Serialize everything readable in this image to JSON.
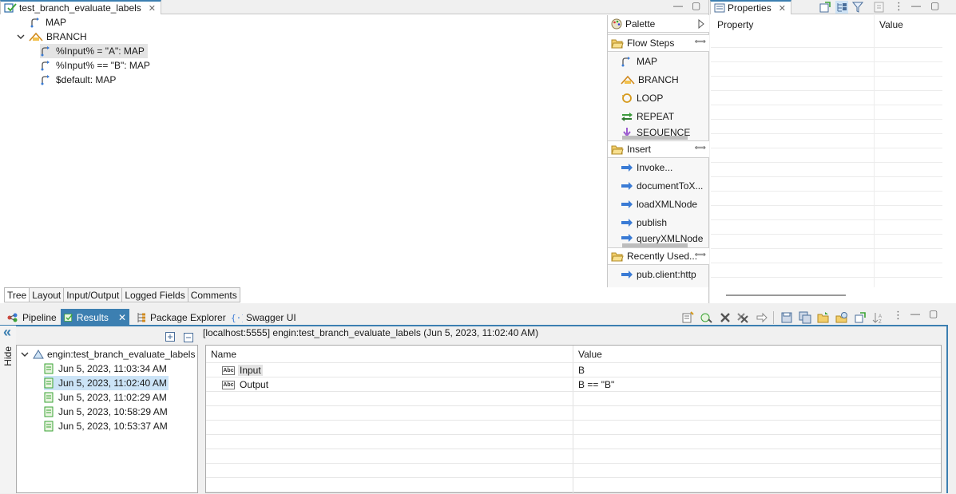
{
  "editor": {
    "tab_title": "test_branch_evaluate_labels",
    "close_glyph": "✕",
    "minimize_glyph": "—",
    "maximize_glyph": "▢",
    "tree": [
      {
        "label": "MAP",
        "icon": "map-icon"
      },
      {
        "label": "BRANCH",
        "icon": "branch-icon",
        "expanded": true
      },
      {
        "label": "%Input% = \"A\": MAP",
        "icon": "map-icon",
        "selected": true
      },
      {
        "label": "%Input% == \"B\": MAP",
        "icon": "map-icon"
      },
      {
        "label": "$default: MAP",
        "icon": "map-icon"
      }
    ],
    "bottom_tabs": [
      "Tree",
      "Layout",
      "Input/Output",
      "Logged Fields",
      "Comments"
    ]
  },
  "palette": {
    "title": "Palette",
    "flow_steps": {
      "title": "Flow Steps",
      "items": [
        "MAP",
        "BRANCH",
        "LOOP",
        "REPEAT",
        "SEQUENCE"
      ]
    },
    "insert": {
      "title": "Insert",
      "items": [
        "Invoke...",
        "documentToX...",
        "loadXMLNode",
        "publish",
        "queryXMLNode"
      ]
    },
    "recently_used": {
      "title": "Recently Used...",
      "items": [
        "pub.client:http"
      ]
    }
  },
  "properties": {
    "tab_title": "Properties",
    "col_property": "Property",
    "col_value": "Value"
  },
  "bottom": {
    "tabs": [
      {
        "label": "Pipeline",
        "icon": "pipeline-icon"
      },
      {
        "label": "Results",
        "icon": "results-icon",
        "active": true
      },
      {
        "label": "Package Explorer",
        "icon": "package-explorer-icon"
      },
      {
        "label": "Swagger UI",
        "icon": "swagger-icon"
      }
    ],
    "hide_label": "Hide",
    "collapse_glyph": "«",
    "history_root": "engin:test_branch_evaluate_labels",
    "history": [
      "Jun 5, 2023, 11:03:34 AM",
      "Jun 5, 2023, 11:02:40 AM",
      "Jun 5, 2023, 11:02:29 AM",
      "Jun 5, 2023, 10:58:29 AM",
      "Jun 5, 2023, 10:53:37 AM"
    ],
    "selected_history_index": 1,
    "result_header": "[localhost:5555] engin:test_branch_evaluate_labels (Jun 5, 2023, 11:02:40 AM)",
    "col_name": "Name",
    "col_value": "Value",
    "rows": [
      {
        "name": "Input",
        "value": "B"
      },
      {
        "name": "Output",
        "value": "B == \"B\""
      }
    ],
    "abc_icon_text": "Abc"
  },
  "colors": {
    "accent": "#3c7fb1",
    "selection": "#cce4f7"
  }
}
